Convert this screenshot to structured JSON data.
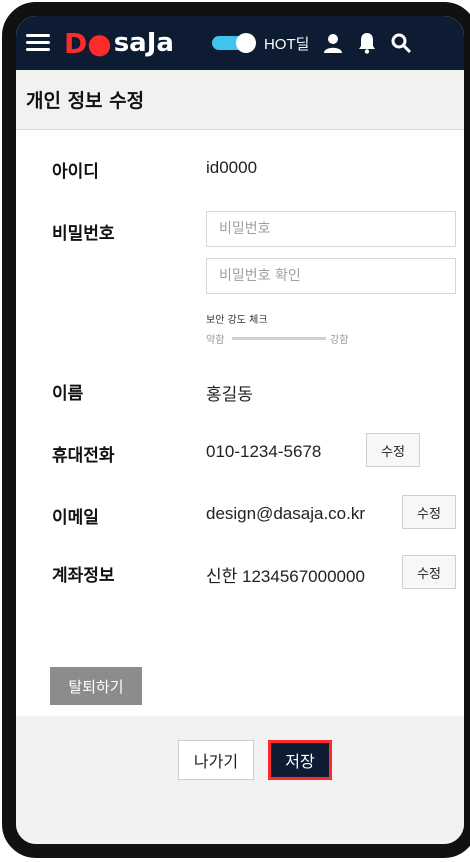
{
  "header": {
    "logo": {
      "mark": "D",
      "rest": "saJa"
    },
    "toggle_on": true,
    "hot_deal_label": "HOT딜",
    "icons": [
      "menu-icon",
      "user-icon",
      "bell-icon",
      "search-icon"
    ],
    "colors": {
      "header_bg": "#0d1b33",
      "brand_red": "#ff2b2b",
      "toggle": "#3fc4f0"
    }
  },
  "page": {
    "title": "개인 정보 수정"
  },
  "form": {
    "id": {
      "label": "아이디",
      "value": "id0000"
    },
    "password": {
      "label": "비밀번호",
      "placeholder": "비밀번호",
      "confirm_placeholder": "비밀번호 확인",
      "strength_title": "보안 강도 체크",
      "weak_label": "약함",
      "strong_label": "강함"
    },
    "name": {
      "label": "이름",
      "value": "홍길동"
    },
    "phone": {
      "label": "휴대전화",
      "value": "010-1234-5678",
      "edit_label": "수정"
    },
    "email": {
      "label": "이메일",
      "value": "design@dasaja.co.kr",
      "edit_label": "수정"
    },
    "account": {
      "label": "계좌정보",
      "value": "신한 1234567000000",
      "edit_label": "수정"
    }
  },
  "actions": {
    "withdraw_label": "탈퇴하기",
    "exit_label": "나가기",
    "save_label": "저장"
  }
}
